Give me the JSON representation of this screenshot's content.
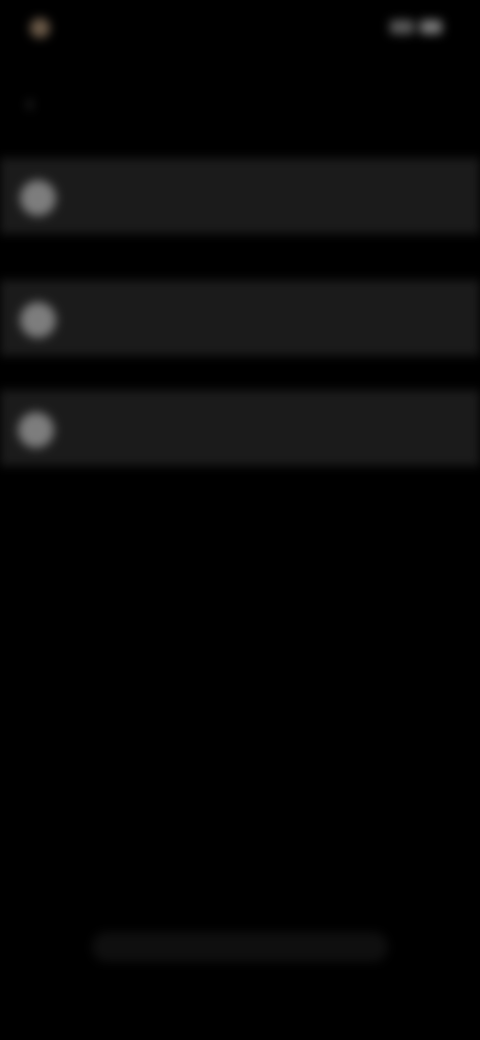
{
  "theme": {
    "background": "#000000",
    "row_background": "#1b1b1b",
    "icon_color": "#7d7d7d"
  },
  "status_bar": {
    "left_icon": "app-indicator-icon",
    "time": "",
    "right_icons": [
      "signal-icon",
      "battery-icon"
    ]
  },
  "header": {
    "back_icon": "back-arrow-icon",
    "title": ""
  },
  "list": {
    "items": [
      {
        "icon": "circle-icon",
        "label": ""
      },
      {
        "icon": "circle-icon",
        "label": ""
      },
      {
        "icon": "circle-icon",
        "label": ""
      }
    ]
  },
  "bottom": {
    "label": ""
  }
}
